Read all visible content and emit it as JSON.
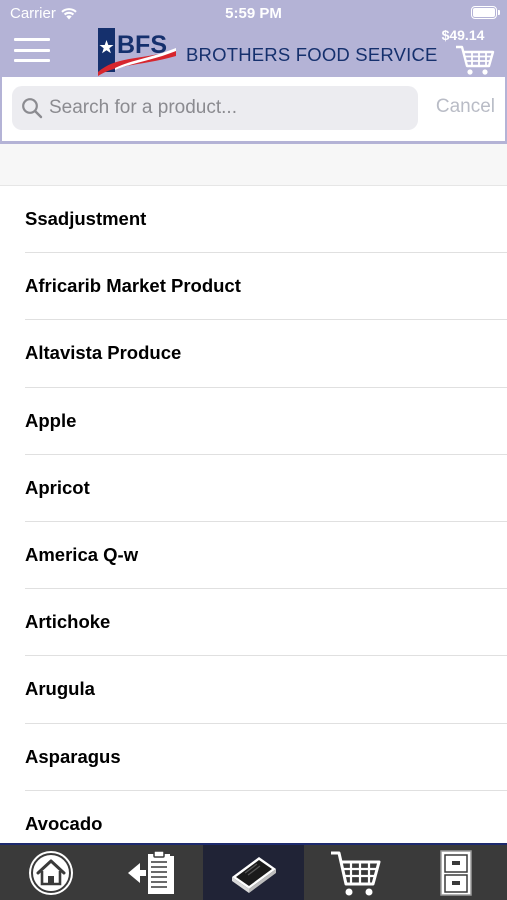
{
  "status_bar": {
    "carrier": "Carrier",
    "time": "5:59 PM"
  },
  "header": {
    "logo_text": "BFS",
    "brand_name": "BROTHERS FOOD SERVICE",
    "cart_total": "$49.14",
    "colors": {
      "header_bg": "#b4b3d6",
      "brand_navy": "#15306d",
      "brand_red": "#d7262e"
    }
  },
  "search": {
    "placeholder": "Search for a product...",
    "value": "",
    "cancel_label": "Cancel"
  },
  "products": [
    "Ssadjustment",
    "Africarib Market Product",
    "Altavista Produce",
    "Apple",
    "Apricot",
    "America Q-w",
    "Artichoke",
    "Arugula",
    "Asparagus",
    "Avocado"
  ],
  "tab_bar": {
    "tabs": [
      {
        "icon": "home-icon",
        "active": false
      },
      {
        "icon": "order-list-icon",
        "active": false
      },
      {
        "icon": "catalog-book-icon",
        "active": true
      },
      {
        "icon": "cart-icon",
        "active": false
      },
      {
        "icon": "file-cabinet-icon",
        "active": false
      }
    ]
  }
}
